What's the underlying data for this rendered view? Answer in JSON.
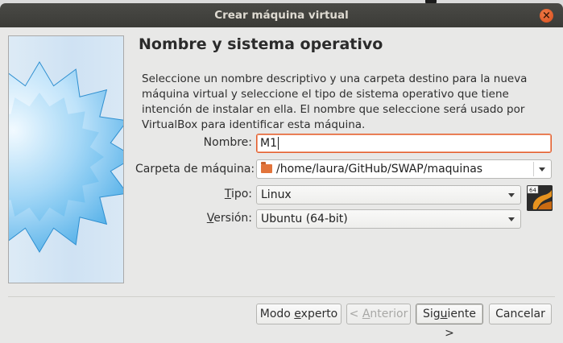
{
  "window": {
    "title": "Crear máquina virtual"
  },
  "page": {
    "heading": "Nombre y sistema operativo",
    "description": "Seleccione un nombre descriptivo y una carpeta destino para la nueva máquina virtual y seleccione el tipo de sistema operativo que tiene intención de instalar en ella. El nombre que seleccione será usado por VirtualBox para identificar esta máquina."
  },
  "form": {
    "name_label": "Nombre:",
    "name_value": "M1",
    "folder_label": "Carpeta de máquina:",
    "folder_value": "/home/laura/GitHub/SWAP/maquinas",
    "type_label_pre": "",
    "type_label_u": "T",
    "type_label_post": "ipo:",
    "type_value": "Linux",
    "version_label_pre": "",
    "version_label_u": "V",
    "version_label_post": "ersión:",
    "version_value": "Ubuntu (64-bit)",
    "os_badge": "64"
  },
  "buttons": {
    "expert_pre": "Modo ",
    "expert_u": "e",
    "expert_post": "xperto",
    "back_pre": "< ",
    "back_u": "A",
    "back_post": "nterior",
    "next_pre": "Sig",
    "next_u": "u",
    "next_post": "iente >",
    "cancel": "Cancelar"
  },
  "icons": {
    "close": "close-icon",
    "folder": "folder-icon",
    "os": "ubuntu-os-icon",
    "dropdown": "chevron-down-icon",
    "wizard": "wizard-star-graphic"
  },
  "colors": {
    "titlebar": "#3e3e3a",
    "accent_focus": "#e35d2c",
    "window_bg": "#e8e8e7",
    "close": "#e15a2c"
  }
}
